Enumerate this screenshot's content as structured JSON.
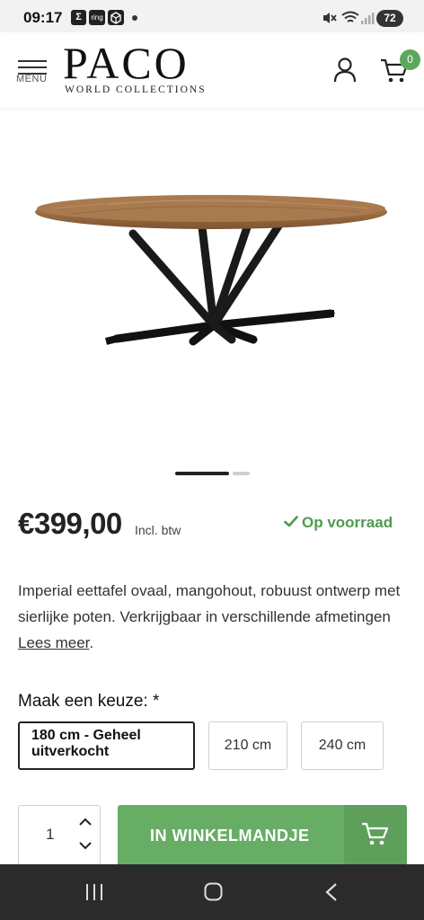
{
  "status_bar": {
    "time": "09:17",
    "notif_icons": [
      "Σ",
      "ring"
    ],
    "battery": "72"
  },
  "header": {
    "menu_label": "MENU",
    "logo": "PACO",
    "logo_sub": "WORLD COLLECTIONS",
    "cart_count": "0"
  },
  "product": {
    "price": "€399,00",
    "price_note": "Incl. btw",
    "stock_status": "Op voorraad",
    "description": "Imperial eettafel ovaal, mangohout, robuust ontwerp met sierlijke poten. Verkrijgbaar in verschillende afmetingen ",
    "read_more": "Lees meer",
    "description_end": "."
  },
  "options": {
    "label": "Maak een keuze:  *",
    "items": [
      {
        "label": "180 cm - Geheel uitverkocht",
        "selected": true
      },
      {
        "label": "210 cm",
        "selected": false
      },
      {
        "label": "240 cm",
        "selected": false
      }
    ]
  },
  "cart": {
    "quantity": "1",
    "add_label": "IN WINKELMANDJE"
  },
  "colors": {
    "accent_green": "#68ad66",
    "stock_green": "#4e9a4e",
    "nav_bar": "#2b2b2b"
  }
}
